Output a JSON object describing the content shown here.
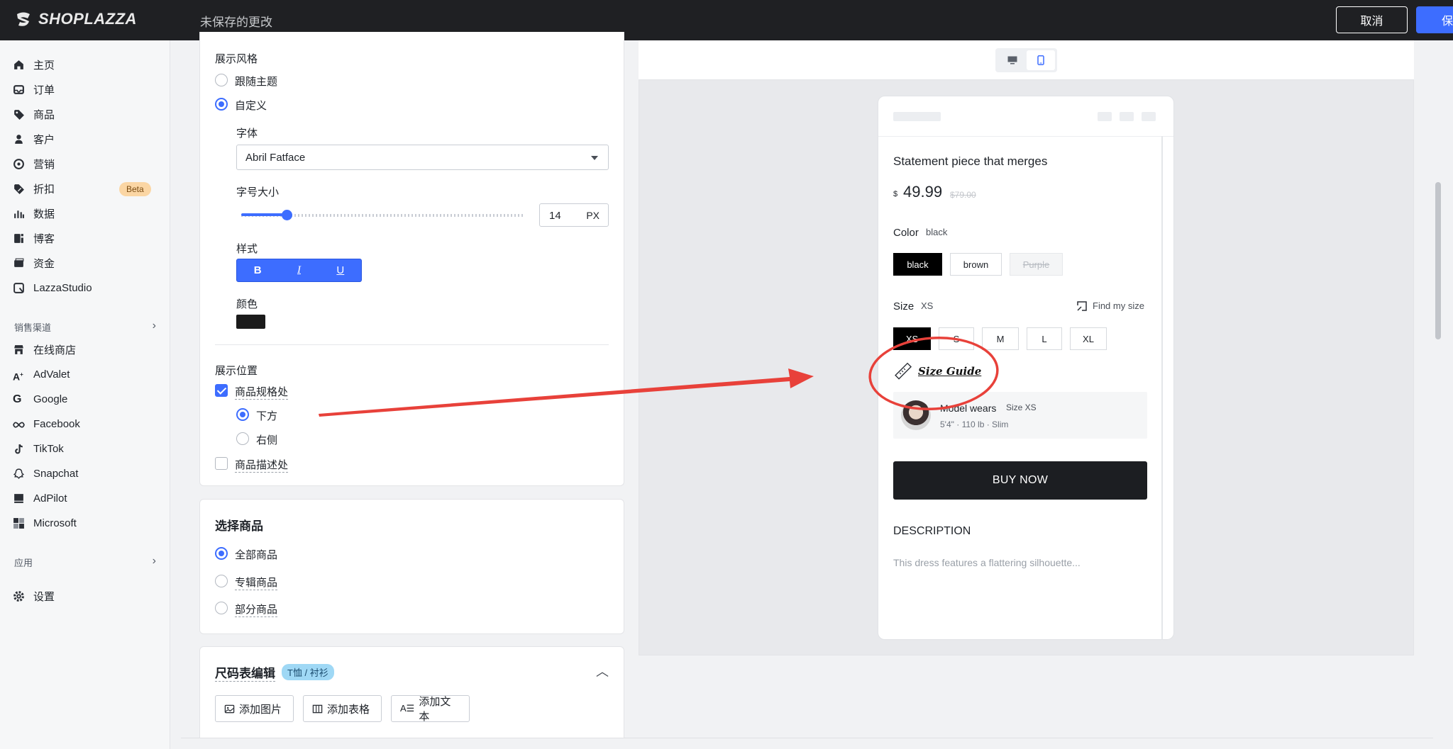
{
  "topbar": {
    "brand": "SHOPLAZZA",
    "unsaved_text": "未保存的更改",
    "cancel_label": "取消",
    "save_label": "保存"
  },
  "sidebar": {
    "items": [
      {
        "label": "主页",
        "icon": "home-icon"
      },
      {
        "label": "订单",
        "icon": "inbox-icon"
      },
      {
        "label": "商品",
        "icon": "tag-icon"
      },
      {
        "label": "客户",
        "icon": "user-icon"
      },
      {
        "label": "营销",
        "icon": "target-icon"
      },
      {
        "label": "折扣",
        "icon": "discount-icon",
        "badge": "Beta"
      },
      {
        "label": "数据",
        "icon": "bar-chart-icon"
      },
      {
        "label": "博客",
        "icon": "blog-icon"
      },
      {
        "label": "资金",
        "icon": "wallet-icon"
      },
      {
        "label": "LazzaStudio",
        "icon": "studio-icon"
      }
    ],
    "sales_channels_label": "销售渠道",
    "channels": [
      {
        "label": "在线商店",
        "icon": "store-icon"
      },
      {
        "label": "AdValet",
        "icon": "advalet-icon"
      },
      {
        "label": "Google",
        "icon": "google-icon"
      },
      {
        "label": "Facebook",
        "icon": "meta-icon"
      },
      {
        "label": "TikTok",
        "icon": "tiktok-icon"
      },
      {
        "label": "Snapchat",
        "icon": "snapchat-icon"
      },
      {
        "label": "AdPilot",
        "icon": "adpilot-icon"
      },
      {
        "label": "Microsoft",
        "icon": "microsoft-icon"
      }
    ],
    "apps_label": "应用",
    "settings_label": "设置"
  },
  "display_style": {
    "title": "展示风格",
    "option_follow_theme": "跟随主题",
    "option_custom": "自定义",
    "font_label": "字体",
    "font_value": "Abril Fatface",
    "size_label": "字号大小",
    "size_value": "14",
    "size_unit": "PX",
    "size_slider_fraction": 0.16,
    "style_label": "样式",
    "style_bold": "B",
    "style_italic": "I",
    "style_underline": "U",
    "color_label": "颜色",
    "color_value": "#1b1b1b"
  },
  "display_position": {
    "title": "展示位置",
    "option_variant": "商品规格处",
    "option_below": "下方",
    "option_right": "右侧",
    "option_description": "商品描述处"
  },
  "select_products": {
    "title": "选择商品",
    "option_all": "全部商品",
    "option_collection": "专辑商品",
    "option_partial": "部分商品"
  },
  "size_chart": {
    "title": "尺码表编辑",
    "tag": "T恤 / 衬衫",
    "add_image": "添加图片",
    "add_table": "添加表格",
    "add_text": "添加文本"
  },
  "preview": {
    "product_title": "Statement piece that merges",
    "currency": "$",
    "price": "49.99",
    "compare_price": "$79.00",
    "color_label": "Color",
    "color_selected": "black",
    "colors": [
      "black",
      "brown",
      "Purple"
    ],
    "size_label": "Size",
    "size_selected": "XS",
    "find_my_size": "Find my size",
    "sizes": [
      "XS",
      "S",
      "M",
      "L",
      "XL"
    ],
    "size_guide": "Size Guide",
    "model_wears": "Model wears",
    "model_size": "Size XS",
    "model_stats": "5'4\" · 110 lb · Slim",
    "buy_now": "BUY NOW",
    "description_title": "DESCRIPTION",
    "description_text": "This dress features a flattering silhouette..."
  },
  "colors": {
    "accent": "#3d6dff",
    "topbar": "#1f2023",
    "annotation": "#e8413a",
    "beta_badge": "#fbd6a4"
  }
}
